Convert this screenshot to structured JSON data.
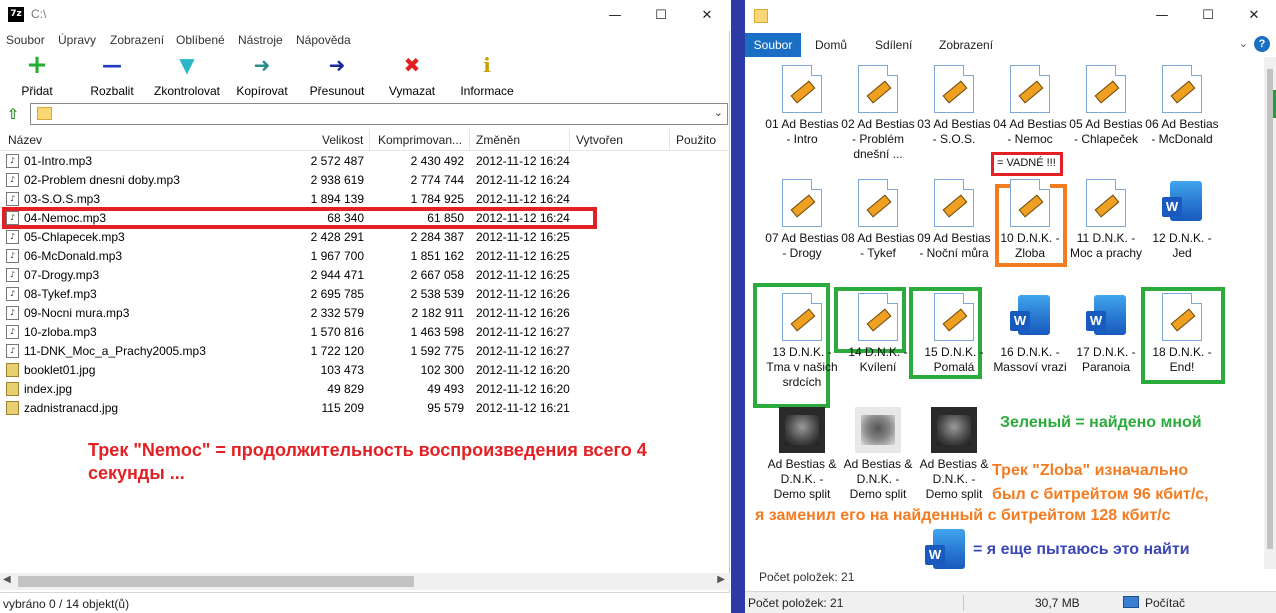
{
  "zip": {
    "app_icon": "7z",
    "title": "C:\\",
    "window_buttons": {
      "minimize": "—",
      "maximize": "☐",
      "close": "✕"
    },
    "menu": [
      "Soubor",
      "Úpravy",
      "Zobrazení",
      "Oblíbené",
      "Nástroje",
      "Nápověda"
    ],
    "toolbar": [
      {
        "label": "Přidat",
        "icon": "add-icon",
        "glyph": "+",
        "color": "#1fae2e"
      },
      {
        "label": "Rozbalit",
        "icon": "extract-icon",
        "glyph": "—",
        "color": "#1f3fc0"
      },
      {
        "label": "Zkontrolovat",
        "icon": "test-icon",
        "glyph": "▼",
        "color": "#29b6c6"
      },
      {
        "label": "Kopírovat",
        "icon": "copy-icon",
        "glyph": "➜",
        "color": "#2a8a8a"
      },
      {
        "label": "Přesunout",
        "icon": "move-icon",
        "glyph": "➜",
        "color": "#1a2a9a"
      },
      {
        "label": "Vymazat",
        "icon": "delete-icon",
        "glyph": "✖",
        "color": "#e02020"
      },
      {
        "label": "Informace",
        "icon": "info-icon",
        "glyph": "i",
        "color": "#c9a200"
      }
    ],
    "columns": [
      "Název",
      "Velikost",
      "Komprimovan...",
      "Změněn",
      "Vytvořen",
      "Použito"
    ],
    "files": [
      {
        "name": "01-Intro.mp3",
        "size": "2 572 487",
        "packed": "2 430 492",
        "modified": "2012-11-12 16:24",
        "type": "mp3"
      },
      {
        "name": "02-Problem dnesni doby.mp3",
        "size": "2 938 619",
        "packed": "2 774 744",
        "modified": "2012-11-12 16:24",
        "type": "mp3"
      },
      {
        "name": "03-S.O.S.mp3",
        "size": "1 894 139",
        "packed": "1 784 925",
        "modified": "2012-11-12 16:24",
        "type": "mp3"
      },
      {
        "name": "04-Nemoc.mp3",
        "size": "68 340",
        "packed": "61 850",
        "modified": "2012-11-12 16:24",
        "type": "mp3"
      },
      {
        "name": "05-Chlapecek.mp3",
        "size": "2 428 291",
        "packed": "2 284 387",
        "modified": "2012-11-12 16:25",
        "type": "mp3"
      },
      {
        "name": "06-McDonald.mp3",
        "size": "1 967 700",
        "packed": "1 851 162",
        "modified": "2012-11-12 16:25",
        "type": "mp3"
      },
      {
        "name": "07-Drogy.mp3",
        "size": "2 944 471",
        "packed": "2 667 058",
        "modified": "2012-11-12 16:25",
        "type": "mp3"
      },
      {
        "name": "08-Tykef.mp3",
        "size": "2 695 785",
        "packed": "2 538 539",
        "modified": "2012-11-12 16:26",
        "type": "mp3"
      },
      {
        "name": "09-Nocni mura.mp3",
        "size": "2 332 579",
        "packed": "2 182 911",
        "modified": "2012-11-12 16:26",
        "type": "mp3"
      },
      {
        "name": "10-zloba.mp3",
        "size": "1 570 816",
        "packed": "1 463 598",
        "modified": "2012-11-12 16:27",
        "type": "mp3"
      },
      {
        "name": "11-DNK_Moc_a_Prachy2005.mp3",
        "size": "1 722 120",
        "packed": "1 592 775",
        "modified": "2012-11-12 16:27",
        "type": "mp3"
      },
      {
        "name": "booklet01.jpg",
        "size": "103 473",
        "packed": "102 300",
        "modified": "2012-11-12 16:20",
        "type": "jpg"
      },
      {
        "name": "index.jpg",
        "size": "49 829",
        "packed": "49 493",
        "modified": "2012-11-12 16:20",
        "type": "jpg"
      },
      {
        "name": "zadnistranacd.jpg",
        "size": "115 209",
        "packed": "95 579",
        "modified": "2012-11-12 16:21",
        "type": "jpg"
      }
    ],
    "annotation": "Трек  \"Nemoc\" = продолжительность воспроизведения всего 4 секунды ...",
    "status": "vybráno 0 / 14 objekt(ů)"
  },
  "explorer": {
    "window_buttons": {
      "minimize": "—",
      "maximize": "☐",
      "close": "✕"
    },
    "ribbon": {
      "file_tab": "Soubor",
      "tabs": [
        "Domů",
        "Sdílení",
        "Zobrazení"
      ],
      "help": "?"
    },
    "items": [
      {
        "label": "01 Ad Bestias - Intro",
        "kind": "mp3"
      },
      {
        "label": "02 Ad Bestias - Problém dnešní ...",
        "kind": "mp3"
      },
      {
        "label": "03 Ad Bestias - S.O.S.",
        "kind": "mp3"
      },
      {
        "label": "04 Ad Bestias - Nemoc",
        "kind": "mp3"
      },
      {
        "label": "05 Ad Bestias - Chlapeček",
        "kind": "mp3"
      },
      {
        "label": "06 Ad Bestias - McDonald",
        "kind": "mp3"
      },
      {
        "label": "07 Ad Bestias - Drogy",
        "kind": "mp3"
      },
      {
        "label": "08 Ad Bestias - Tykef",
        "kind": "mp3"
      },
      {
        "label": "09 Ad Bestias - Noční můra",
        "kind": "mp3"
      },
      {
        "label": "10 D.N.K. - Zloba",
        "kind": "mp3"
      },
      {
        "label": "11 D.N.K. - Moc a prachy",
        "kind": "mp3"
      },
      {
        "label": "12 D.N.K. - Jed",
        "kind": "word"
      },
      {
        "label": "13 D.N.K. - Tma v našich srdcích",
        "kind": "mp3"
      },
      {
        "label": "14 D.N.K. - Kvílení",
        "kind": "mp3"
      },
      {
        "label": "15 D.N.K. - Pomalá",
        "kind": "mp3"
      },
      {
        "label": "16 D.N.K. - Massoví vrazi",
        "kind": "word"
      },
      {
        "label": "17 D.N.K. - Paranoia",
        "kind": "word"
      },
      {
        "label": "18 D.N.K. - End!",
        "kind": "mp3"
      },
      {
        "label": "Ad Bestias & D.N.K. - Demo split",
        "kind": "image-dark"
      },
      {
        "label": "Ad Bestias & D.N.K. - Demo split",
        "kind": "image-light"
      },
      {
        "label": "Ad Bestias & D.N.K. - Demo split",
        "kind": "image-dark"
      }
    ],
    "tag_bad": "= VADNÉ !!!",
    "note_green": "Зеленый = найдено мной",
    "note_orange": [
      "Трек  \"Zloba\"  изначально",
      "был с битрейтом 96 кбит/с,",
      "я заменил его на найденный  с битрейтом 128 кбит/с"
    ],
    "note_blue": "= я еще пытаюсь это найти",
    "status_ghost": "Počet položek: 21",
    "status": {
      "count": "Počet položek: 21",
      "size": "30,7 MB",
      "location": "Počítač"
    },
    "colors": {
      "red": "#e32024",
      "orange": "#f47b20",
      "green": "#2bab3b",
      "blue": "#3c47b7",
      "accent": "#1a6fc4"
    }
  }
}
